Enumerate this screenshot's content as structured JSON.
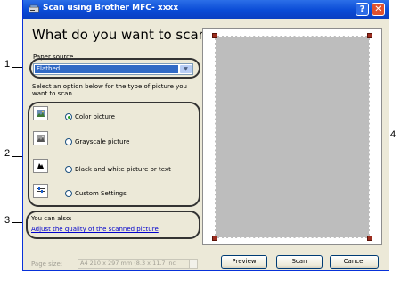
{
  "window": {
    "title": "Scan using Brother MFC- xxxx",
    "help_glyph": "?",
    "close_glyph": "✕"
  },
  "heading": "What do you want to scan?",
  "paper_source": {
    "label": "Paper source",
    "value": "Flatbed",
    "dropdown_glyph": "▼"
  },
  "options_intro_line1": "Select an option below for the type of picture you",
  "options_intro_line2": "want to scan.",
  "options": [
    {
      "label": "Color picture",
      "selected": true
    },
    {
      "label": "Grayscale picture",
      "selected": false
    },
    {
      "label": "Black and white picture or text",
      "selected": false
    },
    {
      "label": "Custom Settings",
      "selected": false
    }
  ],
  "also": {
    "label": "You can also:",
    "link": "Adjust the quality of the scanned picture"
  },
  "page_size": {
    "label": "Page size:",
    "value": "A4 210 x 297 mm (8.3 x 11.7 inc"
  },
  "buttons": {
    "preview": "Preview",
    "scan": "Scan",
    "cancel": "Cancel"
  },
  "callouts": [
    "1",
    "2",
    "3",
    "4"
  ]
}
